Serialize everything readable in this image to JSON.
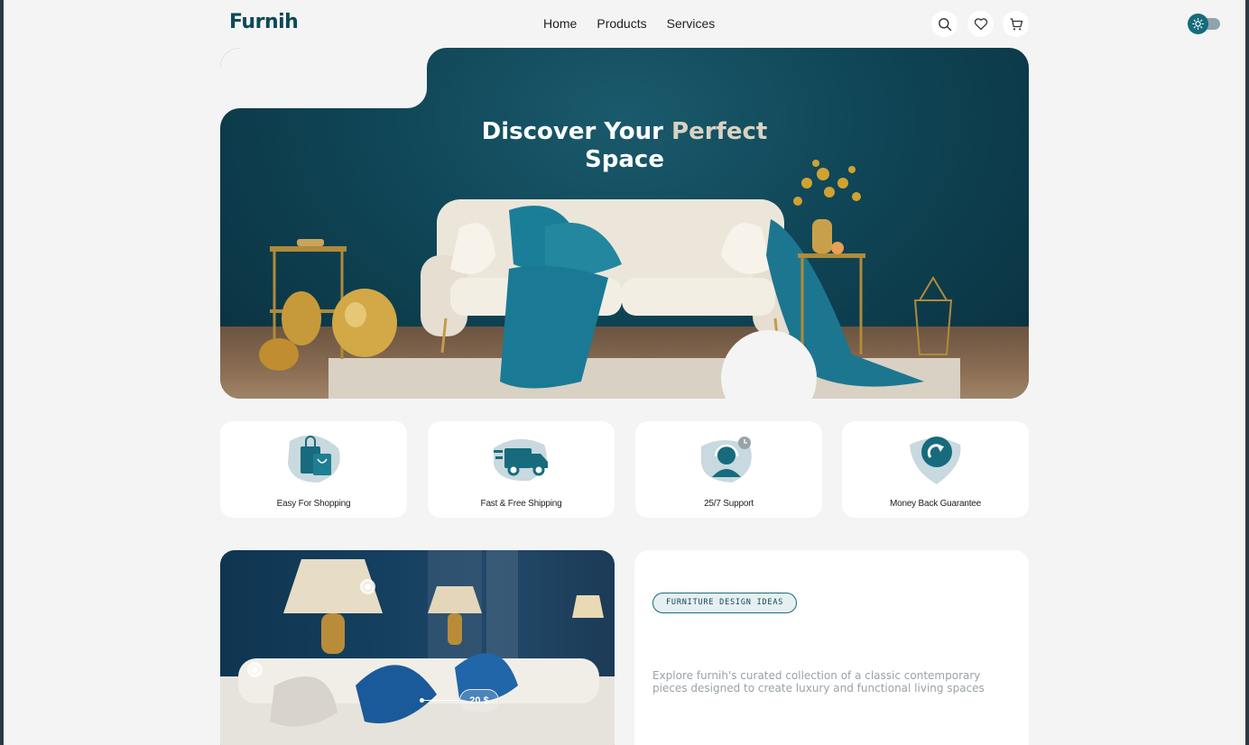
{
  "brand": {
    "logo_text": "Furnih"
  },
  "nav": {
    "items": [
      {
        "label": "Home"
      },
      {
        "label": "Products"
      },
      {
        "label": "Services"
      }
    ]
  },
  "header_icons": [
    "search-icon",
    "heart-icon",
    "cart-icon"
  ],
  "theme_toggle": {
    "icon": "sun-icon",
    "state": "light"
  },
  "hero": {
    "title_line1_main": "Discover Your ",
    "title_line1_accent": "Perfect",
    "title_line2": "Space"
  },
  "features": [
    {
      "label": "Easy For Shopping",
      "icon": "shopping-bag-icon"
    },
    {
      "label": "Fast & Free Shipping",
      "icon": "truck-icon"
    },
    {
      "label": "25/7 Support",
      "icon": "support-headset-icon"
    },
    {
      "label": "Money Back Guarantee",
      "icon": "money-back-icon"
    }
  ],
  "promo": {
    "tag": "FURNITURE DESIGN IDEAS",
    "description": "Explore furnih's curated collection of a classic contemporary pieces designed to create luxury and functional living spaces",
    "price_label": "20.$"
  },
  "colors": {
    "brand": "#0d4a55",
    "accent": "#176b7d",
    "background": "#f4f4f4"
  }
}
